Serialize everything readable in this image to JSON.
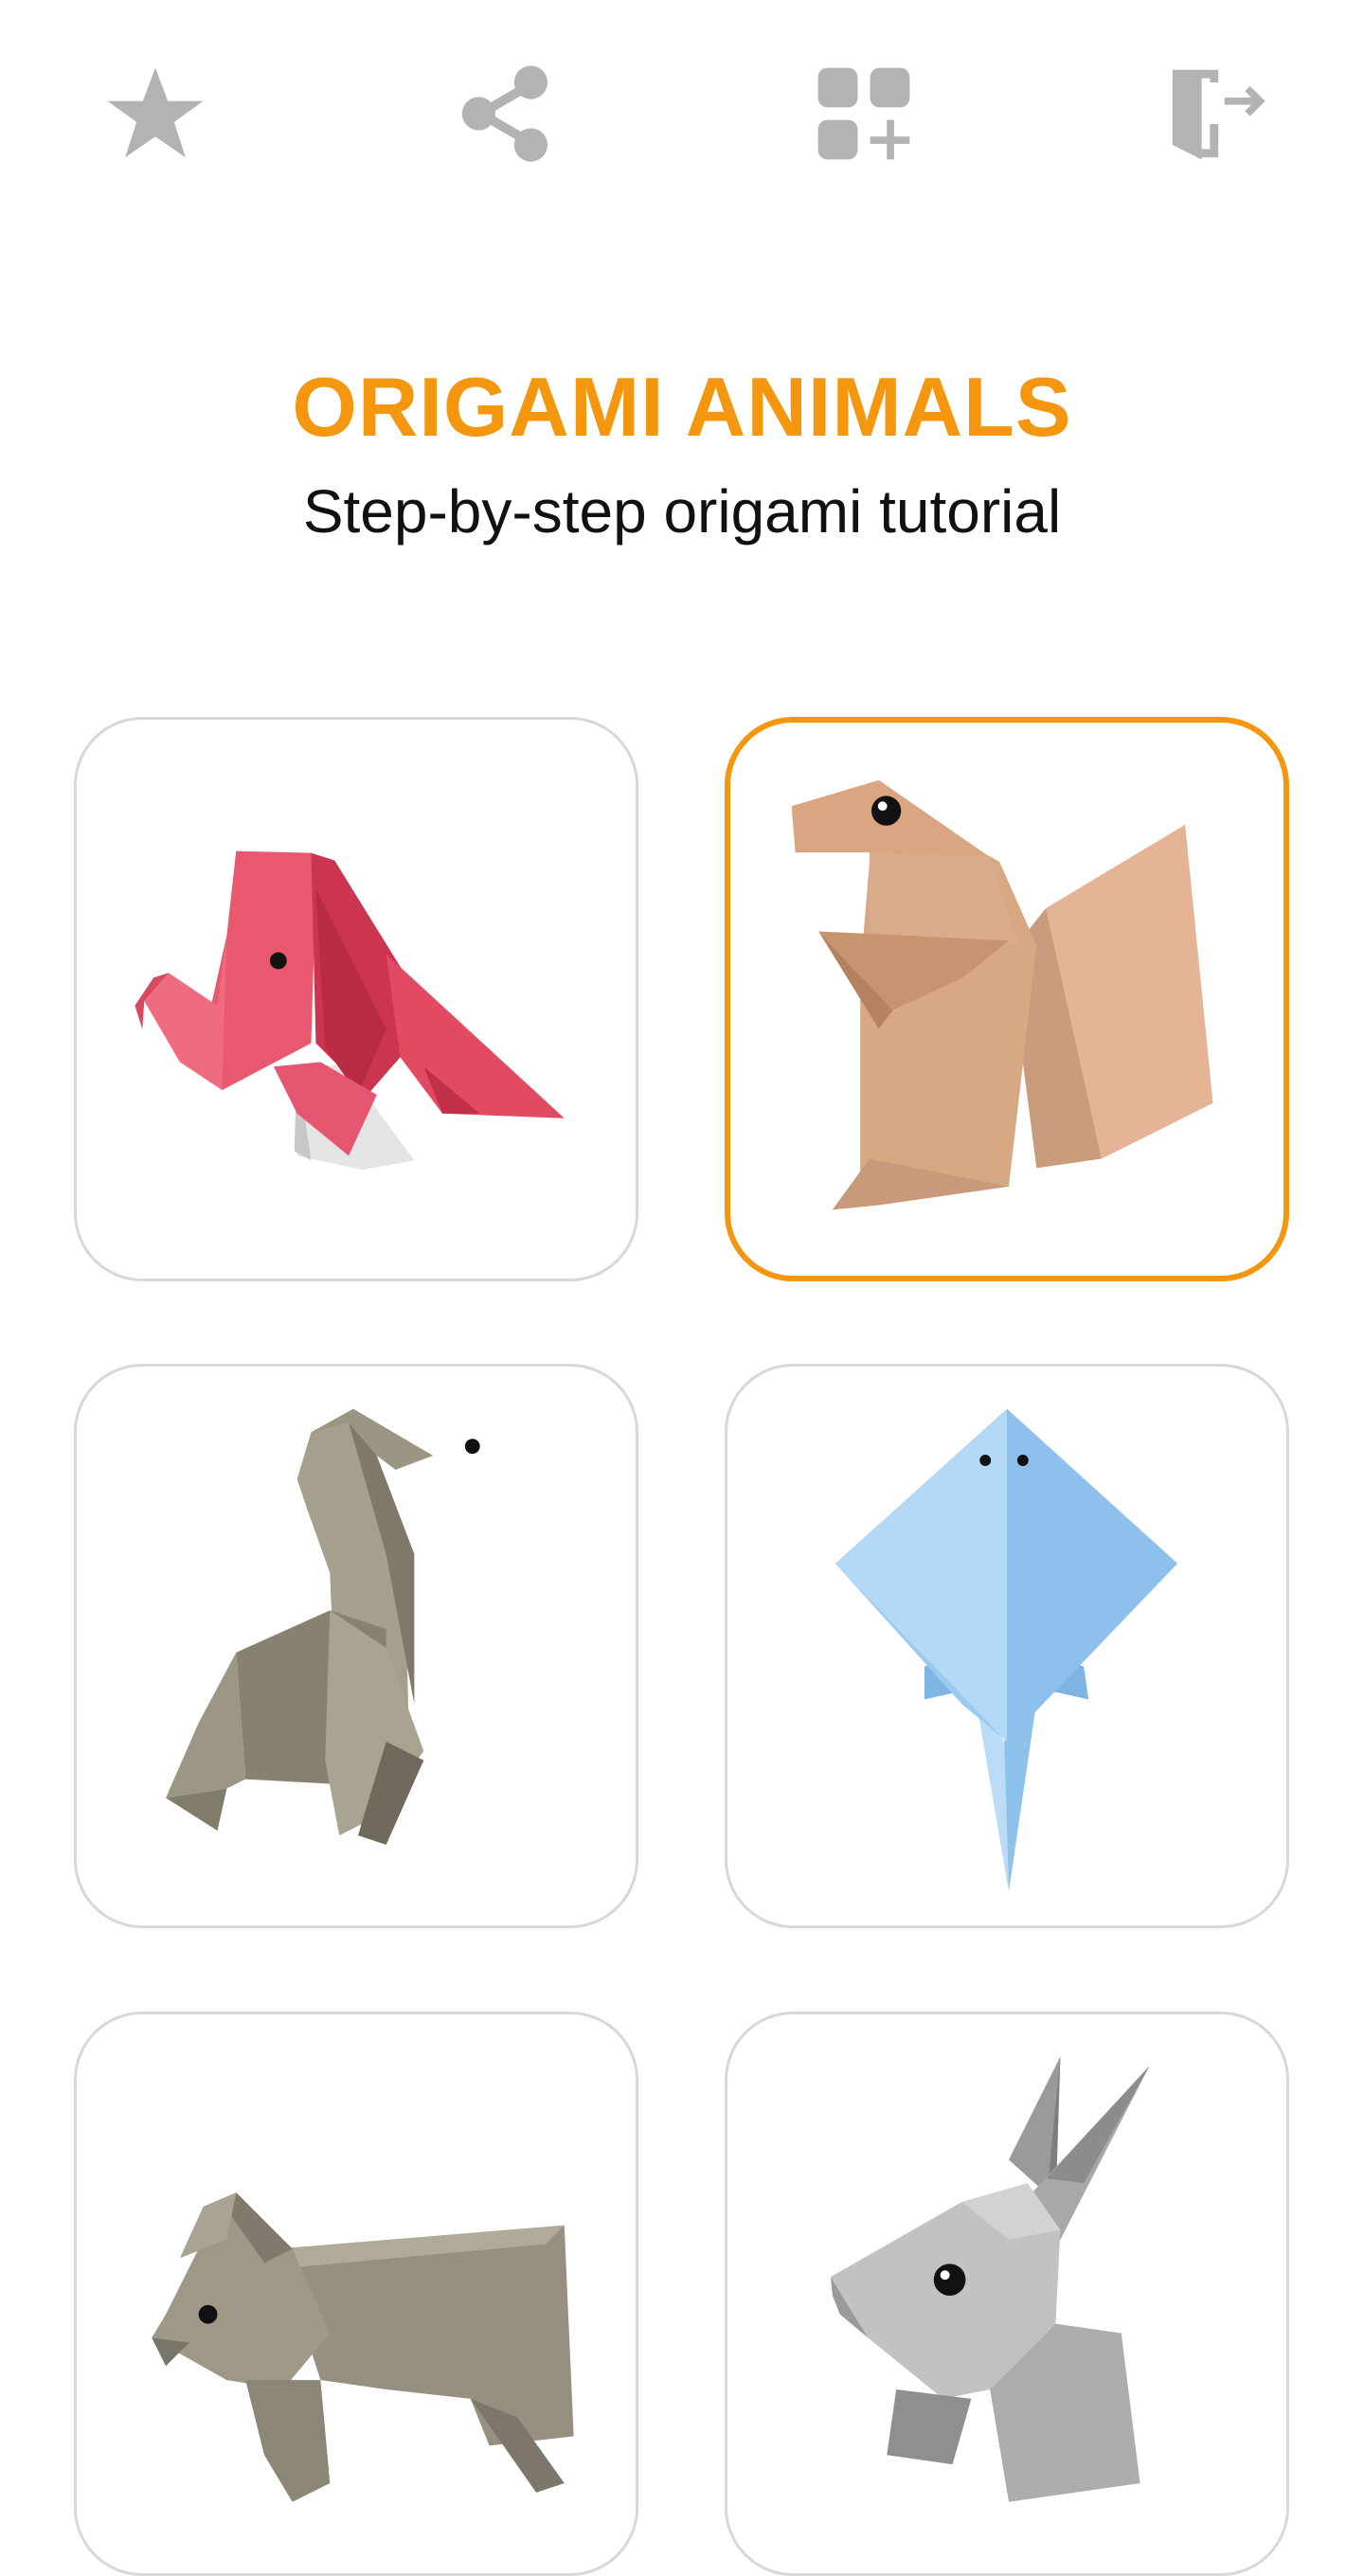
{
  "app": {
    "title": "ORIGAMI ANIMALS",
    "subtitle": "Step-by-step origami tutorial"
  },
  "toolbar": {
    "buttons": [
      {
        "name": "rate",
        "icon": "star-icon"
      },
      {
        "name": "share",
        "icon": "share-icon"
      },
      {
        "name": "more-apps",
        "icon": "apps-add-icon"
      },
      {
        "name": "exit",
        "icon": "exit-door-icon"
      }
    ]
  },
  "colors": {
    "accent": "#F5960F",
    "icon_gray": "#B3B3B3",
    "card_border": "#D8D8D8",
    "subtitle": "#111111"
  },
  "grid": {
    "cards": [
      {
        "animal": "elephant",
        "icon": "origami-elephant-icon",
        "selected": false
      },
      {
        "animal": "squirrel",
        "icon": "origami-squirrel-icon",
        "selected": true
      },
      {
        "animal": "camel",
        "icon": "origami-camel-icon",
        "selected": false
      },
      {
        "animal": "stingray",
        "icon": "origami-stingray-icon",
        "selected": false
      },
      {
        "animal": "dog",
        "icon": "origami-dog-icon",
        "selected": false
      },
      {
        "animal": "rabbit",
        "icon": "origami-rabbit-icon",
        "selected": false
      }
    ]
  }
}
